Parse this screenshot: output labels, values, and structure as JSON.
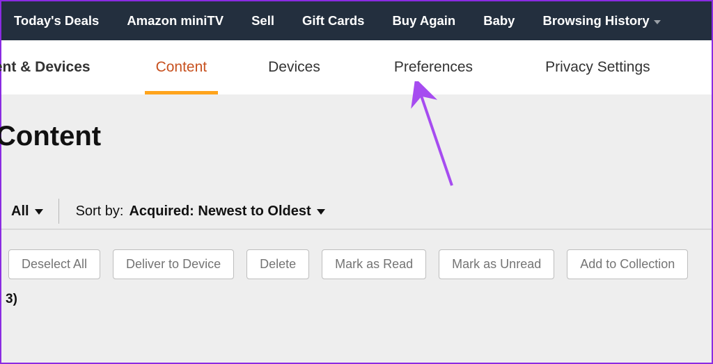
{
  "topnav": {
    "items": [
      {
        "label": "Today's Deals"
      },
      {
        "label": "Amazon miniTV"
      },
      {
        "label": "Sell"
      },
      {
        "label": "Gift Cards"
      },
      {
        "label": "Buy Again"
      },
      {
        "label": "Baby"
      },
      {
        "label": "Browsing History",
        "has_dropdown": true
      }
    ]
  },
  "subnav": {
    "section_title": "ntent & Devices",
    "tabs": [
      {
        "label": "Content",
        "active": true
      },
      {
        "label": "Devices"
      },
      {
        "label": "Preferences"
      },
      {
        "label": "Privacy Settings"
      }
    ]
  },
  "page": {
    "title": "Content"
  },
  "filter": {
    "all_label": "All",
    "sort_prefix": "Sort by:",
    "sort_value": "Acquired: Newest to Oldest"
  },
  "actions": {
    "deselect_all": "Deselect All",
    "deliver": "Deliver to Device",
    "delete": "Delete",
    "mark_read": "Mark as Read",
    "mark_unread": "Mark as Unread",
    "add_collection": "Add to Collection"
  },
  "count": {
    "text": "3)"
  },
  "annotation": {
    "arrow_color": "#a64cf0"
  }
}
